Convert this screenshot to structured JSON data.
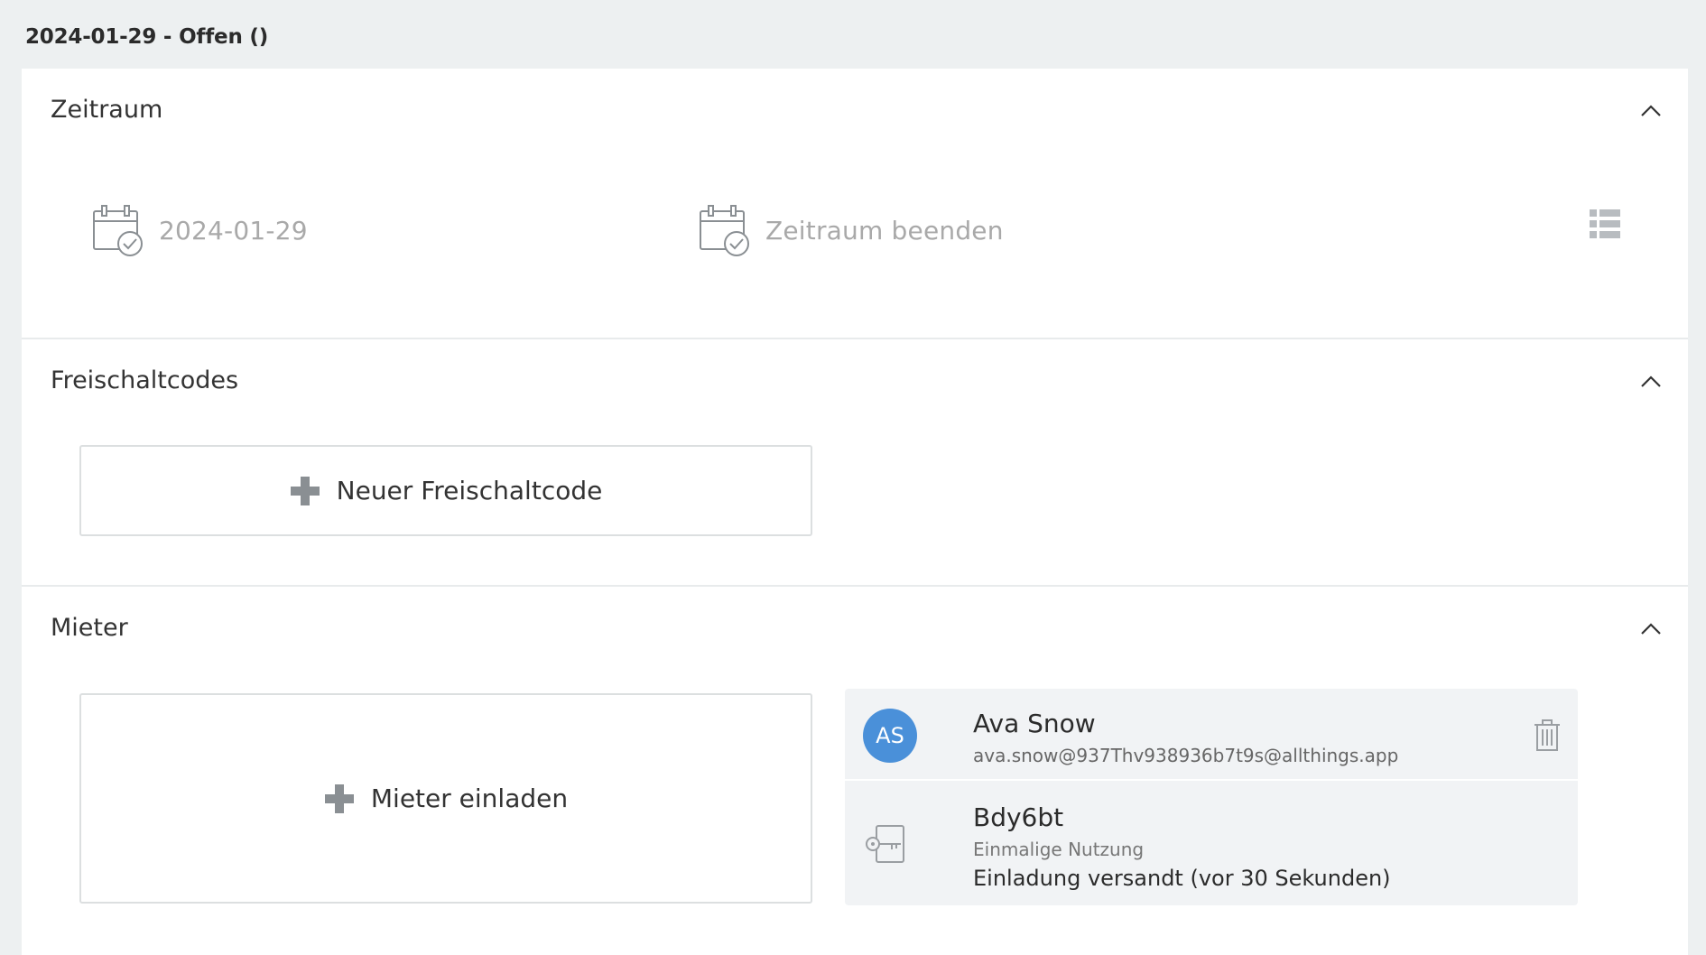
{
  "heading": "2024-01-29 - Offen ()",
  "sections": {
    "period": {
      "title": "Zeitraum",
      "start_label": "2024-01-29",
      "end_label": "Zeitraum beenden"
    },
    "codes": {
      "title": "Freischaltcodes",
      "add_label": "Neuer Freischaltcode"
    },
    "tenants": {
      "title": "Mieter",
      "invite_label": "Mieter einladen",
      "tenant": {
        "initials": "AS",
        "name": "Ava Snow",
        "email": "ava.snow@937Thv938936b7t9s@allthings.app"
      },
      "code": {
        "name": "Bdy6bt",
        "usage": "Einmalige Nutzung",
        "status": "Einladung versandt (vor 30 Sekunden)"
      }
    }
  },
  "colors": {
    "background": "#edf0f1",
    "panel": "#ffffff",
    "avatar": "#4a90d9",
    "card": "#f1f3f5",
    "muted_text": "#a9a9a9",
    "icon_gray": "#8a8f93"
  },
  "icons": [
    "calendar-check-icon",
    "list-view-icon",
    "chevron-up-icon",
    "plus-icon",
    "trash-icon",
    "key-icon"
  ]
}
